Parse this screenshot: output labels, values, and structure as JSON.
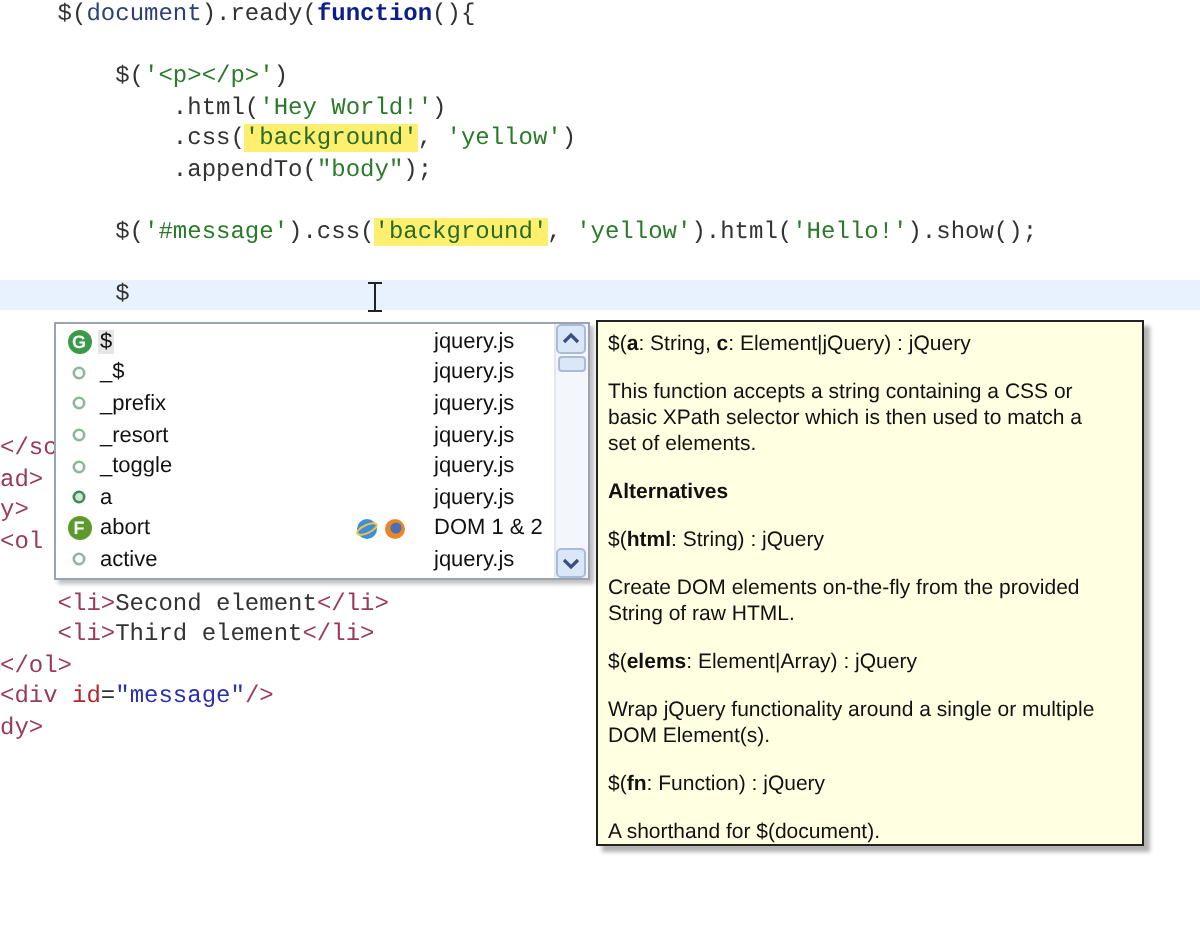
{
  "editor": {
    "lines": [
      {
        "kind": "code",
        "tokens": [
          {
            "kind": "plain",
            "text": "    $("
          },
          {
            "kind": "ident",
            "text": "document"
          },
          {
            "kind": "plain",
            "text": ").ready("
          },
          {
            "kind": "keyword",
            "text": "function"
          },
          {
            "kind": "plain",
            "text": "(){"
          }
        ]
      },
      {
        "kind": "blank"
      },
      {
        "kind": "code",
        "tokens": [
          {
            "kind": "plain",
            "text": "        $("
          },
          {
            "kind": "string",
            "text": "'<p></p>'"
          },
          {
            "kind": "plain",
            "text": ")"
          }
        ]
      },
      {
        "kind": "code",
        "tokens": [
          {
            "kind": "plain",
            "text": "            .html("
          },
          {
            "kind": "string",
            "text": "'Hey World!'"
          },
          {
            "kind": "plain",
            "text": ")"
          }
        ]
      },
      {
        "kind": "code",
        "tokens": [
          {
            "kind": "plain",
            "text": "            .css("
          },
          {
            "kind": "marked",
            "text": "'background'"
          },
          {
            "kind": "plain",
            "text": ", "
          },
          {
            "kind": "string",
            "text": "'yellow'"
          },
          {
            "kind": "plain",
            "text": ")"
          }
        ]
      },
      {
        "kind": "code",
        "tokens": [
          {
            "kind": "plain",
            "text": "            .appendTo("
          },
          {
            "kind": "string",
            "text": "\"body\""
          },
          {
            "kind": "plain",
            "text": ");"
          }
        ]
      },
      {
        "kind": "blank"
      },
      {
        "kind": "code",
        "tokens": [
          {
            "kind": "plain",
            "text": "        $("
          },
          {
            "kind": "string",
            "text": "'#message'"
          },
          {
            "kind": "plain",
            "text": ").css("
          },
          {
            "kind": "marked",
            "text": "'background'"
          },
          {
            "kind": "plain",
            "text": ", "
          },
          {
            "kind": "string",
            "text": "'yellow'"
          },
          {
            "kind": "plain",
            "text": ").html("
          },
          {
            "kind": "string",
            "text": "'Hello!'"
          },
          {
            "kind": "plain",
            "text": ").show();"
          }
        ]
      },
      {
        "kind": "blank"
      },
      {
        "kind": "current",
        "tokens": [
          {
            "kind": "plain",
            "text": "        $"
          }
        ]
      },
      {
        "kind": "blank"
      },
      {
        "kind": "blank"
      },
      {
        "kind": "blank"
      },
      {
        "kind": "blank"
      },
      {
        "kind": "code",
        "tokens": [
          {
            "kind": "tag",
            "text": "</sc"
          }
        ]
      },
      {
        "kind": "code",
        "tokens": [
          {
            "kind": "tag",
            "text": "ad>"
          }
        ]
      },
      {
        "kind": "code",
        "tokens": [
          {
            "kind": "tag",
            "text": "y>"
          }
        ]
      },
      {
        "kind": "code",
        "tokens": [
          {
            "kind": "tag",
            "text": "<ol"
          }
        ]
      },
      {
        "kind": "blank"
      },
      {
        "kind": "code",
        "tokens": [
          {
            "kind": "tag",
            "text": "    <li>"
          },
          {
            "kind": "plain",
            "text": "Second element"
          },
          {
            "kind": "tag",
            "text": "</li>"
          }
        ]
      },
      {
        "kind": "code",
        "tokens": [
          {
            "kind": "tag",
            "text": "    <li>"
          },
          {
            "kind": "plain",
            "text": "Third element"
          },
          {
            "kind": "tag",
            "text": "</li>"
          }
        ]
      },
      {
        "kind": "code",
        "tokens": [
          {
            "kind": "tag",
            "text": "</ol>"
          }
        ]
      },
      {
        "kind": "code",
        "tokens": [
          {
            "kind": "tag",
            "text": "<div "
          },
          {
            "kind": "attr",
            "text": "id"
          },
          {
            "kind": "plain",
            "text": "="
          },
          {
            "kind": "value",
            "text": "\"message\""
          },
          {
            "kind": "tag",
            "text": "/>"
          }
        ]
      },
      {
        "kind": "code",
        "tokens": [
          {
            "kind": "tag",
            "text": "dy>"
          }
        ]
      }
    ]
  },
  "completion": {
    "items": [
      {
        "kind": "global",
        "badge": "G",
        "name": "$",
        "source": "jquery.js",
        "selected": true,
        "browser_icons": false
      },
      {
        "kind": "field",
        "name": "_$",
        "source": "jquery.js",
        "selected": false,
        "browser_icons": false
      },
      {
        "kind": "field",
        "name": "_prefix",
        "source": "jquery.js",
        "selected": false,
        "browser_icons": false
      },
      {
        "kind": "field",
        "name": "_resort",
        "source": "jquery.js",
        "selected": false,
        "browser_icons": false
      },
      {
        "kind": "field",
        "name": "_toggle",
        "source": "jquery.js",
        "selected": false,
        "browser_icons": false
      },
      {
        "kind": "var",
        "name": "a",
        "source": "jquery.js",
        "selected": false,
        "browser_icons": false
      },
      {
        "kind": "function",
        "badge": "F",
        "name": "abort",
        "source": "DOM 1 & 2",
        "selected": false,
        "browser_icons": true
      },
      {
        "kind": "field",
        "name": "active",
        "source": "jquery.js",
        "selected": false,
        "browser_icons": false
      }
    ]
  },
  "doc_tooltip": {
    "blocks": [
      {
        "kind": "signature",
        "text": "$(**a**: String, **c**: Element|jQuery) : jQuery"
      },
      {
        "kind": "text",
        "text": "This function accepts a string containing a CSS or basic XPath selector which is then used to match a set of elements."
      },
      {
        "kind": "heading",
        "text": "Alternatives"
      },
      {
        "kind": "signature",
        "text": "$(**html**: String) : jQuery"
      },
      {
        "kind": "text",
        "text": "Create DOM elements on-the-fly from the provided String of raw HTML."
      },
      {
        "kind": "signature",
        "text": "$(**elems**: Element|Array) : jQuery"
      },
      {
        "kind": "text",
        "text": "Wrap jQuery functionality around a single or multiple DOM Element(s)."
      },
      {
        "kind": "signature",
        "text": "$(**fn**: Function) : jQuery"
      },
      {
        "kind": "text",
        "text": "A shorthand for $(document)."
      }
    ]
  }
}
